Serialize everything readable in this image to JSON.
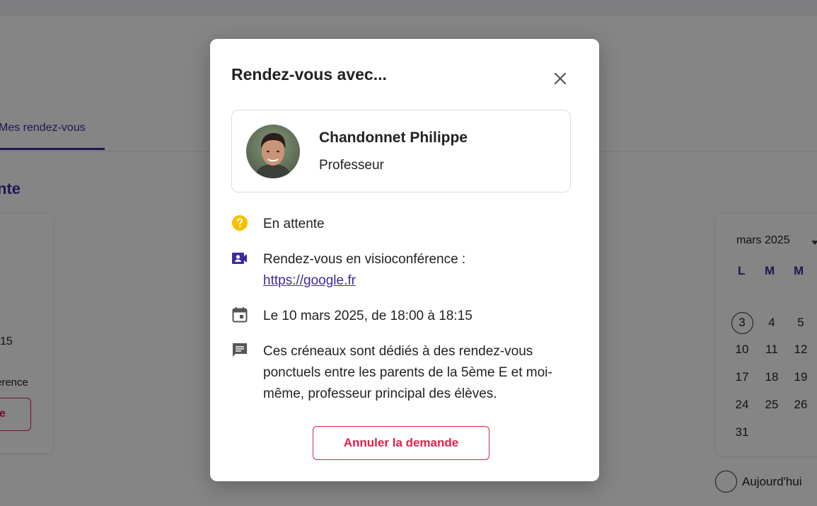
{
  "background": {
    "tab_label": "Mes rendez-vous",
    "section_heading": "nte",
    "slot_time": "15",
    "slot_mode": "érence",
    "slot_button": "e",
    "calendar": {
      "month": "mars 2025",
      "days_of_week": [
        "L",
        "M",
        "M"
      ],
      "rows": [
        [
          "3",
          "4",
          "5"
        ],
        [
          "10",
          "11",
          "12"
        ],
        [
          "17",
          "18",
          "19"
        ],
        [
          "24",
          "25",
          "26"
        ],
        [
          "31",
          "",
          ""
        ]
      ],
      "today_label": "Aujourd'hui"
    }
  },
  "modal": {
    "title": "Rendez-vous avec...",
    "person": {
      "name": "Chandonnet Philippe",
      "role": "Professeur"
    },
    "status": "En attente",
    "visio_label": "Rendez-vous en visioconférence :",
    "visio_link": "https://google.fr",
    "date": "Le 10 mars 2025, de 18:00 à 18:15",
    "comment_line1": "Ces créneaux sont dédiés à des rendez-vous",
    "comment_line2": "ponctuels entre les parents de la 5ème E et moi-",
    "comment_line3": "même, professeur principal des élèves.",
    "cancel_button": "Annuler la demande"
  },
  "colors": {
    "accent": "#3f2a9d",
    "danger": "#e02049",
    "pending": "#f6c000"
  },
  "icons": {
    "status": "help-circle-icon",
    "visio": "video-account-icon",
    "date": "calendar-icon",
    "comment": "comment-icon",
    "close": "close-icon"
  }
}
